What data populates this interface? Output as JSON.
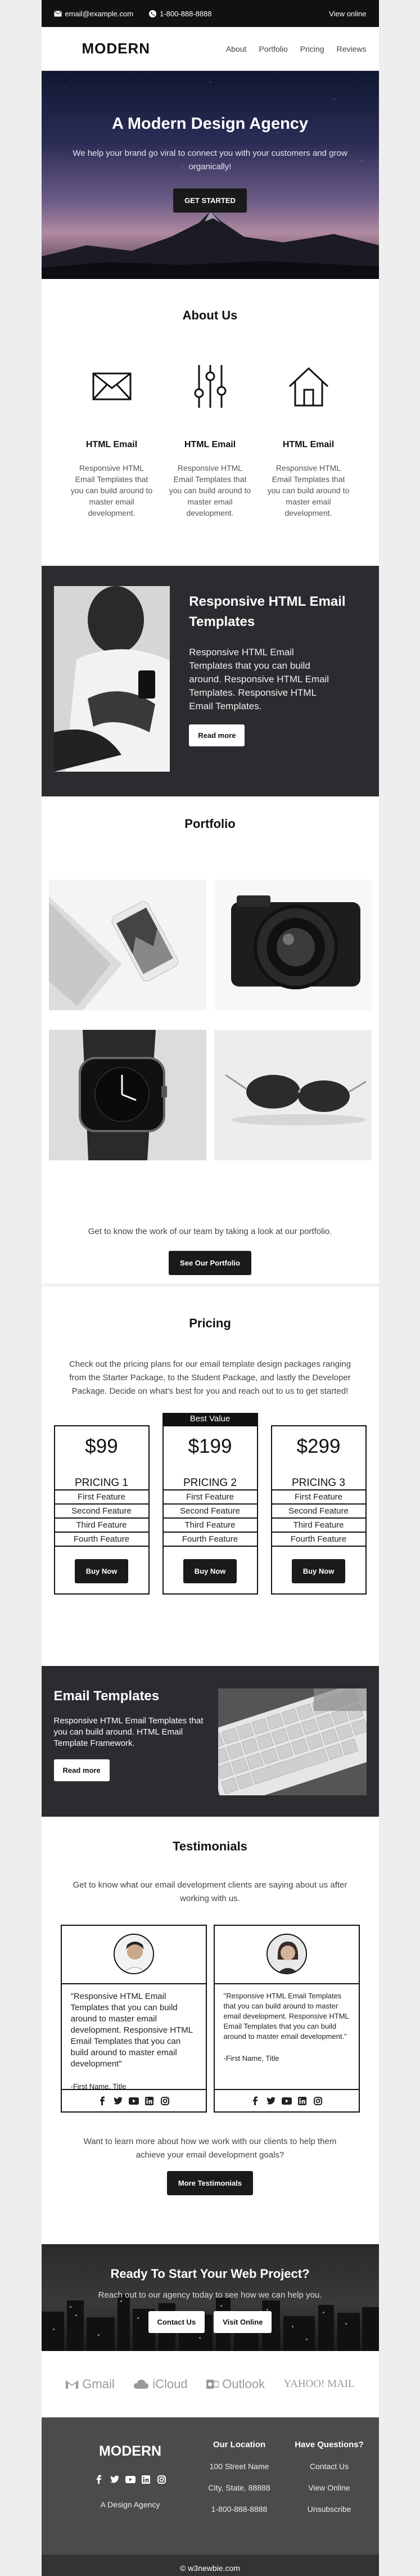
{
  "topbar": {
    "email": "email@example.com",
    "phone": "1-800-888-8888",
    "view_online": "View online"
  },
  "header": {
    "logo": "MODERN",
    "nav": [
      "About",
      "Portfolio",
      "Pricing",
      "Reviews"
    ]
  },
  "hero": {
    "title": "A Modern Design Agency",
    "subtitle": "We help your brand go viral to connect you with your customers and grow organically!",
    "button": "GET STARTED"
  },
  "about": {
    "title": "About Us",
    "features": [
      {
        "icon": "envelope-icon",
        "title": "HTML Email",
        "text": "Responsive HTML Email Templates that you can build around to master email development."
      },
      {
        "icon": "sliders-icon",
        "title": "HTML Email",
        "text": "Responsive HTML Email Templates that you can build around to master email development."
      },
      {
        "icon": "home-icon",
        "title": "HTML Email",
        "text": "Responsive HTML Email Templates that you can build around to master email development."
      }
    ]
  },
  "responsive": {
    "title": "Responsive HTML Email Templates",
    "text": "Responsive HTML Email Templates that you can build around. Responsive HTML Email Templates. Responsive HTML Email Templates.",
    "button": "Read more"
  },
  "portfolio": {
    "title": "Portfolio",
    "intro": "Get to know the work of our team by taking a look at our portfolio.",
    "button": "See Our Portfolio"
  },
  "pricing": {
    "title": "Pricing",
    "description": "Check out the pricing plans for our email template design packages ranging from the Starter Package, to the Student Package, and lastly the Developer Package. Decide on what's best for you and reach out to us to get started!",
    "best_label": "Best Value",
    "plans": [
      {
        "price": "$99",
        "name": "PRICING 1",
        "features": [
          "First Feature",
          "Second Feature",
          "Third Feature",
          "Fourth Feature"
        ],
        "button": "Buy Now"
      },
      {
        "price": "$199",
        "name": "PRICING 2",
        "features": [
          "First Feature",
          "Second Feature",
          "Third Feature",
          "Fourth Feature"
        ],
        "button": "Buy Now"
      },
      {
        "price": "$299",
        "name": "PRICING 3",
        "features": [
          "First Feature",
          "Second Feature",
          "Third Feature",
          "Fourth Feature"
        ],
        "button": "Buy Now"
      }
    ]
  },
  "email_templates": {
    "title": "Email Templates",
    "text": "Responsive HTML Email Templates that you can build around. HTML Email Template Framework.",
    "button": "Read more"
  },
  "testimonials": {
    "title": "Testimonials",
    "intro": "Get to know what our email development clients are saying about us after working with us.",
    "cards": [
      {
        "quote": "\"Responsive HTML Email Templates that you can build around to master email development. Responsive HTML Email Templates that you can build around to master email development\"",
        "author": "-First Name, Title"
      },
      {
        "quote": "\"Responsive HTML Email Templates that you can build around to master email development. Responsive HTML Email Templates that you can build around to master email development.\"",
        "author": "-First Name, Title"
      }
    ],
    "more_text": "Want to learn more about how we work with our clients to help them achieve your email development goals?",
    "button": "More Testimonials"
  },
  "cta": {
    "title": "Ready To Start Your Web Project?",
    "text": "Reach out to our agency today to see how we can help you.",
    "contact": "Contact Us",
    "visit": "Visit Online"
  },
  "logos": [
    "Gmail",
    "iCloud",
    "Outlook",
    "YAHOO! MAIL"
  ],
  "footer": {
    "logo": "MODERN",
    "tagline": "A Design Agency",
    "location_title": "Our Location",
    "address": "100 Street Name",
    "city": "City, State, 88888",
    "phone": "1-800-888-8888",
    "questions_title": "Have Questions?",
    "contact": "Contact Us",
    "view_online": "View Online",
    "unsubscribe": "Unsubscribe",
    "copyright": "© w3newbie.com"
  },
  "colors": {
    "dark": "#2b2c2f",
    "black": "#111111",
    "footer": "#4b4b4b"
  }
}
